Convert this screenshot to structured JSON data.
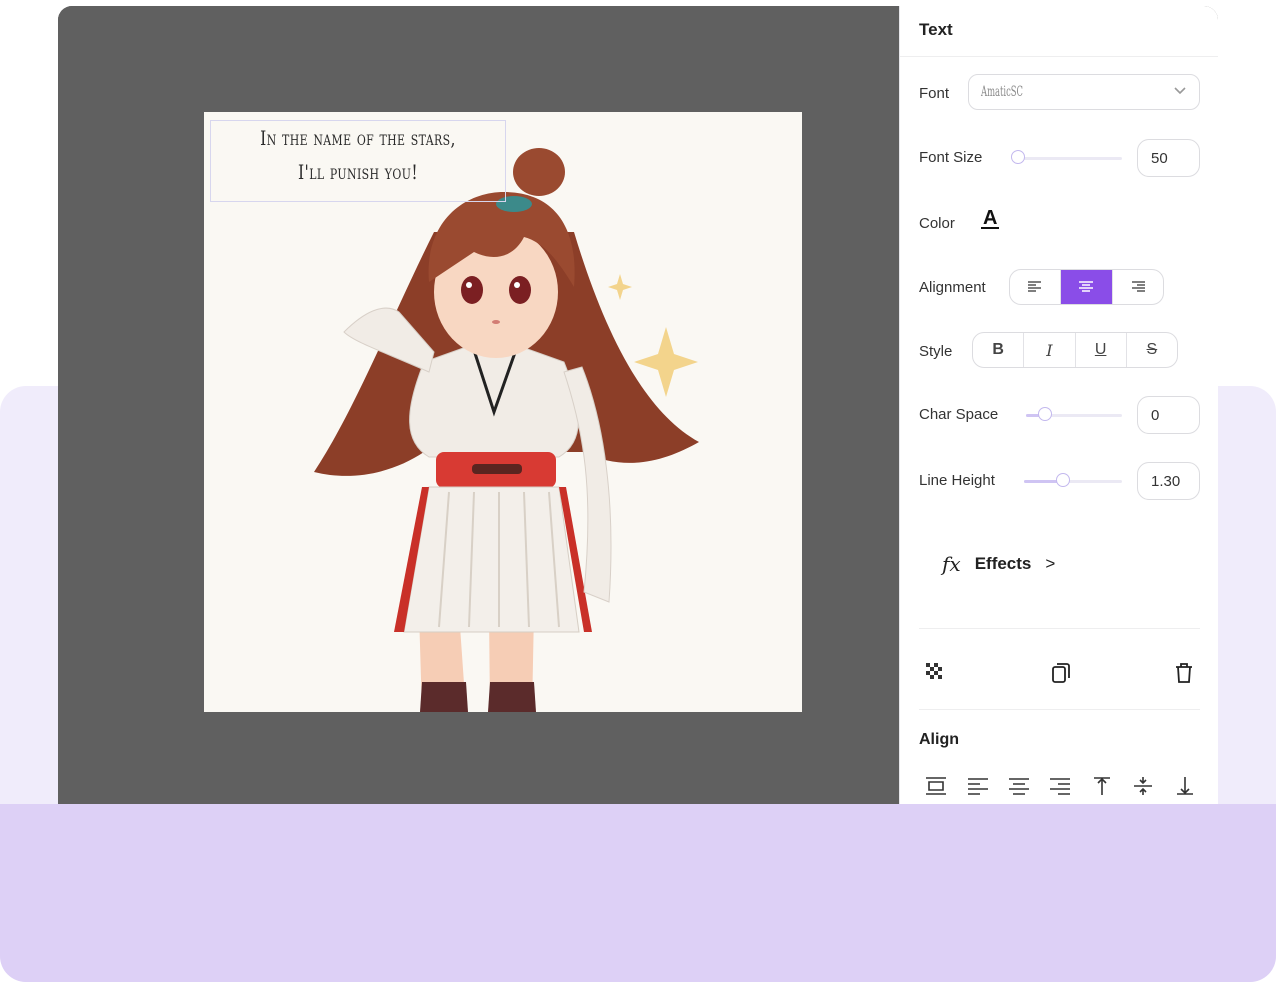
{
  "canvas": {
    "text_lines": [
      "In the name of the stars,",
      "I'll punish you!"
    ]
  },
  "panel": {
    "title": "Text",
    "font": {
      "label": "Font",
      "value": "AmaticSC"
    },
    "font_size": {
      "label": "Font Size",
      "value": "50",
      "level": 0.05
    },
    "color": {
      "label": "Color",
      "glyph": "A",
      "value": "#111111"
    },
    "alignment": {
      "label": "Alignment",
      "options": [
        "align-left-icon",
        "align-center-icon",
        "align-right-icon"
      ],
      "selected": "align-center-icon"
    },
    "style": {
      "label": "Style",
      "options": [
        "B",
        "I",
        "U",
        "S"
      ]
    },
    "char_space": {
      "label": "Char Space",
      "value": "0",
      "level": 0.2
    },
    "line_height": {
      "label": "Line Height",
      "value": "1.30",
      "level": 0.4
    },
    "effects": {
      "icon": "fx",
      "label": "Effects",
      "chevron": ">"
    },
    "actions": [
      "transparency-icon",
      "duplicate-icon",
      "trash-icon"
    ],
    "align_section": {
      "title": "Align",
      "icons": [
        "align-page-icon",
        "align-left-icon",
        "align-center-h-icon",
        "align-right-icon",
        "align-top-icon",
        "align-middle-v-icon",
        "align-bottom-icon"
      ]
    }
  },
  "colors": {
    "accent": "#8a4de8",
    "canvas_bg": "#606060",
    "page_bg_light": "#f0ecfb",
    "page_bg_band": "#ddd0f6"
  }
}
